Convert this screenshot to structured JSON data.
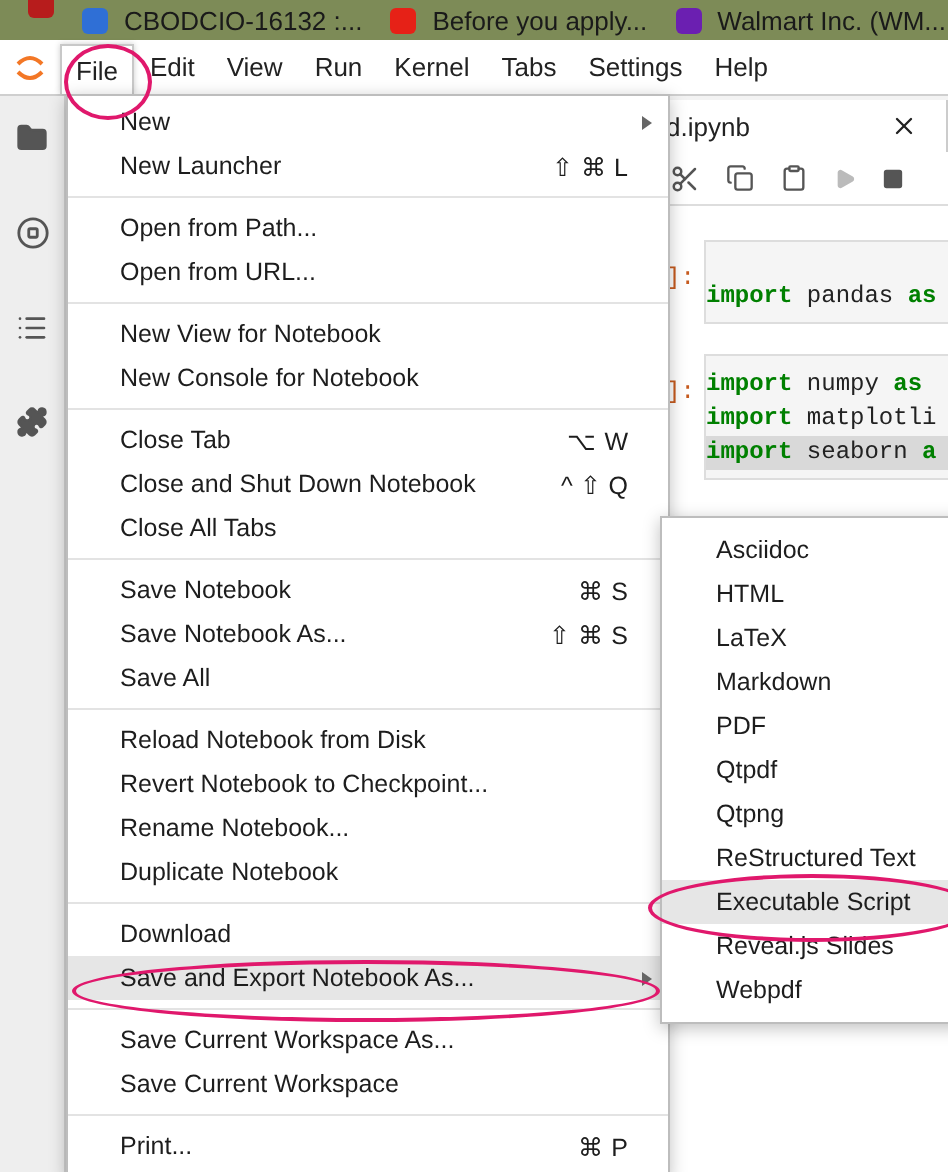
{
  "bookmarks": [
    {
      "label": "CBODCIO-16132 :..."
    },
    {
      "label": "Before you apply..."
    },
    {
      "label": "Walmart Inc. (WM..."
    }
  ],
  "menubar": [
    {
      "label": "File",
      "selected": true
    },
    {
      "label": "Edit",
      "selected": false
    },
    {
      "label": "View",
      "selected": false
    },
    {
      "label": "Run",
      "selected": false
    },
    {
      "label": "Kernel",
      "selected": false
    },
    {
      "label": "Tabs",
      "selected": false
    },
    {
      "label": "Settings",
      "selected": false
    },
    {
      "label": "Help",
      "selected": false
    }
  ],
  "file_menu": [
    [
      {
        "label": "New",
        "submenu": true,
        "selected": false
      },
      {
        "label": "New Launcher",
        "shortcut": "⇧ ⌘ L",
        "submenu": false,
        "selected": false
      }
    ],
    [
      {
        "label": "Open from Path...",
        "submenu": false,
        "selected": false
      },
      {
        "label": "Open from URL...",
        "submenu": false,
        "selected": false
      }
    ],
    [
      {
        "label": "New View for Notebook",
        "submenu": false,
        "selected": false
      },
      {
        "label": "New Console for Notebook",
        "submenu": false,
        "selected": false
      }
    ],
    [
      {
        "label": "Close Tab",
        "shortcut": "⌥ W",
        "submenu": false,
        "selected": false
      },
      {
        "label": "Close and Shut Down Notebook",
        "shortcut": "^ ⇧ Q",
        "submenu": false,
        "selected": false
      },
      {
        "label": "Close All Tabs",
        "submenu": false,
        "selected": false
      }
    ],
    [
      {
        "label": "Save Notebook",
        "shortcut": "⌘ S",
        "submenu": false,
        "selected": false
      },
      {
        "label": "Save Notebook As...",
        "shortcut": "⇧ ⌘ S",
        "submenu": false,
        "selected": false
      },
      {
        "label": "Save All",
        "submenu": false,
        "selected": false
      }
    ],
    [
      {
        "label": "Reload Notebook from Disk",
        "submenu": false,
        "selected": false
      },
      {
        "label": "Revert Notebook to Checkpoint...",
        "submenu": false,
        "selected": false
      },
      {
        "label": "Rename Notebook...",
        "submenu": false,
        "selected": false
      },
      {
        "label": "Duplicate Notebook",
        "submenu": false,
        "selected": false
      }
    ],
    [
      {
        "label": "Download",
        "submenu": false,
        "selected": false
      },
      {
        "label": "Save and Export Notebook As...",
        "submenu": true,
        "selected": true
      }
    ],
    [
      {
        "label": "Save Current Workspace As...",
        "submenu": false,
        "selected": false
      },
      {
        "label": "Save Current Workspace",
        "submenu": false,
        "selected": false
      }
    ],
    [
      {
        "label": "Print...",
        "shortcut": "⌘ P",
        "submenu": false,
        "selected": false
      }
    ]
  ],
  "export_submenu": [
    {
      "label": "Asciidoc",
      "selected": false
    },
    {
      "label": "HTML",
      "selected": false
    },
    {
      "label": "LaTeX",
      "selected": false
    },
    {
      "label": "Markdown",
      "selected": false
    },
    {
      "label": "PDF",
      "selected": false
    },
    {
      "label": "Qtpdf",
      "selected": false
    },
    {
      "label": "Qtpng",
      "selected": false
    },
    {
      "label": "ReStructured Text",
      "selected": false
    },
    {
      "label": "Executable Script",
      "selected": true
    },
    {
      "label": "Reveal.js Slides",
      "selected": false
    },
    {
      "label": "Webpdf",
      "selected": false
    }
  ],
  "notebook": {
    "tab_title": "d.ipynb",
    "cells": [
      {
        "prompt": "]:",
        "lines": [
          {
            "highlighted": false,
            "tokens": [
              {
                "kind": "keyword",
                "text": "import"
              },
              {
                "kind": "name",
                "text": " pandas "
              },
              {
                "kind": "keyword",
                "text": "as"
              }
            ]
          }
        ]
      },
      {
        "prompt": "]:",
        "lines": [
          {
            "highlighted": false,
            "tokens": [
              {
                "kind": "keyword",
                "text": "import"
              },
              {
                "kind": "name",
                "text": " numpy "
              },
              {
                "kind": "keyword",
                "text": "as"
              }
            ]
          },
          {
            "highlighted": false,
            "tokens": [
              {
                "kind": "keyword",
                "text": "import"
              },
              {
                "kind": "name",
                "text": " matplotli"
              }
            ]
          },
          {
            "highlighted": true,
            "tokens": [
              {
                "kind": "keyword",
                "text": "import"
              },
              {
                "kind": "name",
                "text": " seaborn "
              },
              {
                "kind": "keyword",
                "text": "a"
              }
            ]
          }
        ]
      }
    ]
  }
}
